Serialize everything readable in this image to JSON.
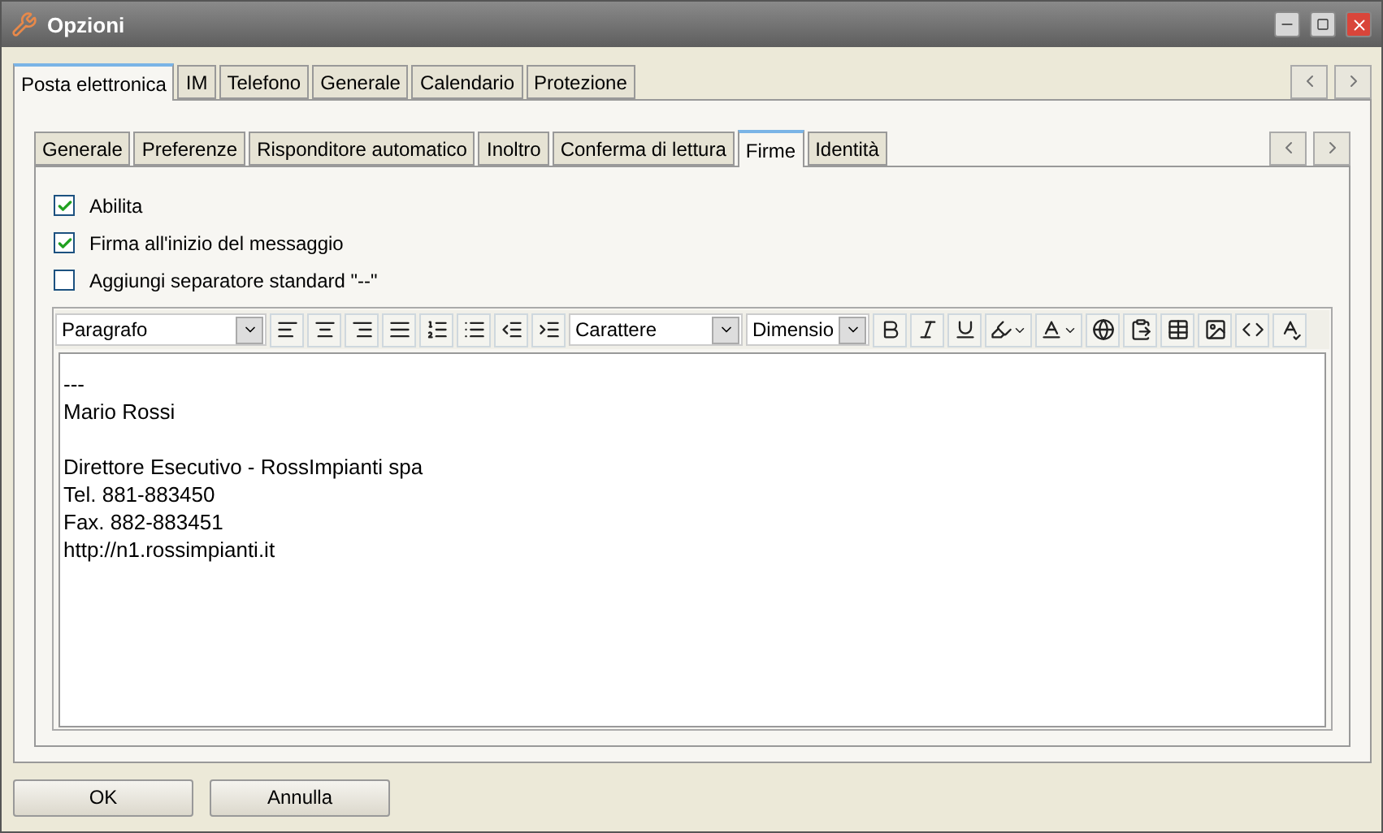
{
  "window": {
    "title": "Opzioni"
  },
  "tabs": [
    {
      "label": "Posta elettronica",
      "selected": true
    },
    {
      "label": "IM",
      "selected": false
    },
    {
      "label": "Telefono",
      "selected": false
    },
    {
      "label": "Generale",
      "selected": false
    },
    {
      "label": "Calendario",
      "selected": false
    },
    {
      "label": "Protezione",
      "selected": false
    }
  ],
  "subtabs": [
    {
      "label": "Generale",
      "selected": false
    },
    {
      "label": "Preferenze",
      "selected": false
    },
    {
      "label": "Risponditore automatico",
      "selected": false
    },
    {
      "label": "Inoltro",
      "selected": false
    },
    {
      "label": "Conferma di lettura",
      "selected": false
    },
    {
      "label": "Firme",
      "selected": true
    },
    {
      "label": "Identità",
      "selected": false
    }
  ],
  "options": [
    {
      "label": "Abilita",
      "checked": true
    },
    {
      "label": "Firma all'inizio del messaggio",
      "checked": true
    },
    {
      "label": "Aggiungi separatore standard \"--\"",
      "checked": false
    }
  ],
  "editor": {
    "format": "Paragrafo",
    "font": "Carattere",
    "size": "Dimensio",
    "paragraphs": [
      [
        "---",
        "Mario Rossi"
      ],
      [
        "Direttore Esecutivo - RossImpianti spa",
        "Tel. 881-883450",
        "Fax. 882-883451",
        "http://n1.rossimpianti.it"
      ]
    ]
  },
  "buttons": [
    "OK",
    "Annulla"
  ]
}
